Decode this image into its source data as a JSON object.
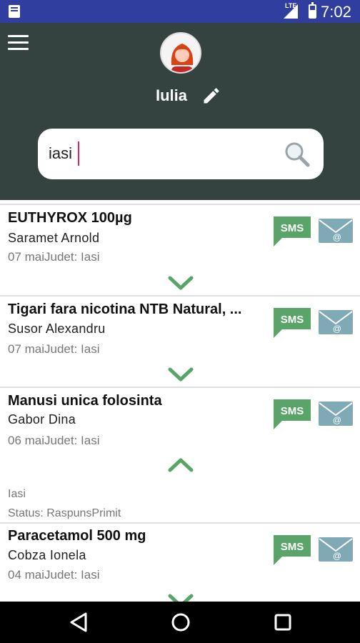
{
  "status_bar": {
    "network_label": "LTE",
    "time": "7:02"
  },
  "header": {
    "user_name": "Iulia",
    "search": {
      "value": "iasi",
      "placeholder": ""
    }
  },
  "items": [
    {
      "title": "EUTHYROX 100µg",
      "person": "Saramet Arnold",
      "meta": "07 maiJudet: Iasi",
      "sms_label": "SMS",
      "expanded": false
    },
    {
      "title": "Tigari fara nicotina NTB Natural, ...",
      "person": "Susor Alexandru",
      "meta": "07 maiJudet: Iasi",
      "sms_label": "SMS",
      "expanded": false
    },
    {
      "title": "Manusi unica folosinta",
      "person": "Gabor Dina",
      "meta": "06 maiJudet: Iasi",
      "sms_label": "SMS",
      "expanded": true,
      "location": "Iasi",
      "status": "Status: RaspunsPrimit"
    },
    {
      "title": "Paracetamol 500 mg",
      "person": "Cobza Ionela",
      "meta": "04 maiJudet: Iasi",
      "sms_label": "SMS",
      "expanded": false
    }
  ],
  "colors": {
    "status_bar": "#303f9f",
    "header": "#344340",
    "accent_green": "#5aa469",
    "mail_blue": "#7fa9b5"
  }
}
